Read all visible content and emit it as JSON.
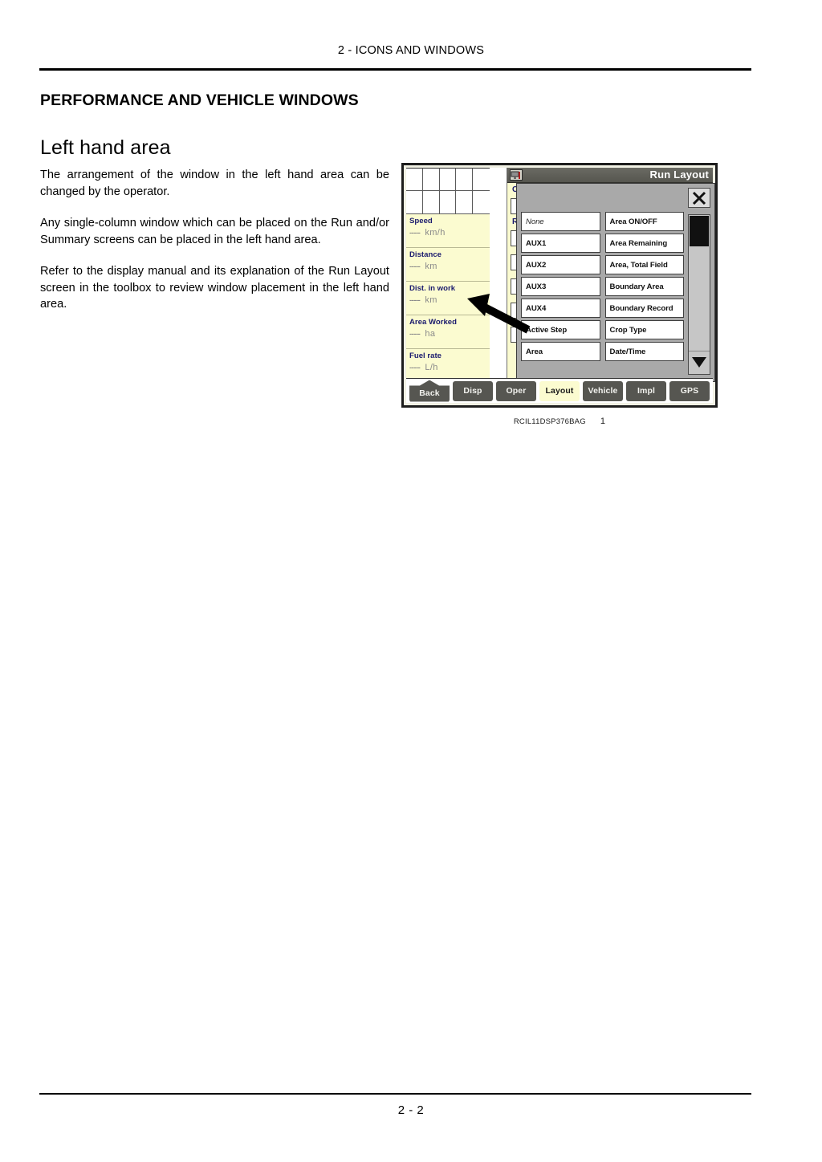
{
  "page": {
    "running_header": "2 - ICONS AND WINDOWS",
    "footer_page_number": "2 - 2"
  },
  "section": {
    "title": "PERFORMANCE AND VEHICLE WINDOWS",
    "subtitle": "Left hand area",
    "paragraphs": [
      "The arrangement of the window in the left hand area can be changed by the operator.",
      "Any single-column window which can be placed on the Run and/or Summary screens can be placed in the left hand area.",
      "Refer to the display manual and its explanation of the Run Layout screen in the toolbox to review window placement in the left hand area."
    ]
  },
  "figure": {
    "caption_code": "RCIL11DSP376BAG",
    "caption_number": "1",
    "screen": {
      "titlebar": {
        "title": "Run Layout",
        "icon": "display-icon"
      },
      "left_hand_panel": {
        "cells": [
          {
            "label": "Speed",
            "dashes": "-----",
            "unit": "km/h"
          },
          {
            "label": "Distance",
            "dashes": "-----",
            "unit": "km"
          },
          {
            "label": "Dist. in work",
            "dashes": "-----",
            "unit": "km"
          },
          {
            "label": "Area Worked",
            "dashes": "-----",
            "unit": "ha"
          },
          {
            "label": "Fuel rate",
            "dashes": "-----",
            "unit": "L/h"
          }
        ]
      },
      "underlying_screen": {
        "partial_labels": [
          "C",
          "R"
        ]
      },
      "dialog": {
        "close_label": "close-icon",
        "items": [
          "None",
          "Area ON/OFF",
          "AUX1",
          "Area Remaining",
          "AUX2",
          "Area, Total Field",
          "AUX3",
          "Boundary Area",
          "AUX4",
          "Boundary Record",
          "Active Step",
          "Crop Type",
          "Area",
          "Date/Time"
        ],
        "scrollbar": {
          "thumb_position": "top",
          "down_arrow": "triangle-down-icon"
        }
      },
      "toolbar": {
        "buttons": [
          {
            "label": "Back",
            "active": false,
            "shape": "pentagon"
          },
          {
            "label": "Disp",
            "active": false,
            "shape": "rect"
          },
          {
            "label": "Oper",
            "active": false,
            "shape": "rect"
          },
          {
            "label": "Layout",
            "active": true,
            "shape": "rect"
          },
          {
            "label": "Vehicle",
            "active": false,
            "shape": "rect"
          },
          {
            "label": "Impl",
            "active": false,
            "shape": "rect"
          },
          {
            "label": "GPS",
            "active": false,
            "shape": "rect"
          }
        ]
      }
    }
  },
  "colors": {
    "screen_yellow": "#FBFBD0",
    "label_navy": "#1B1B6E",
    "titlebar_gray": "#5A5A53",
    "dialog_gray": "#A9A9A9",
    "button_gray": "#565651"
  }
}
